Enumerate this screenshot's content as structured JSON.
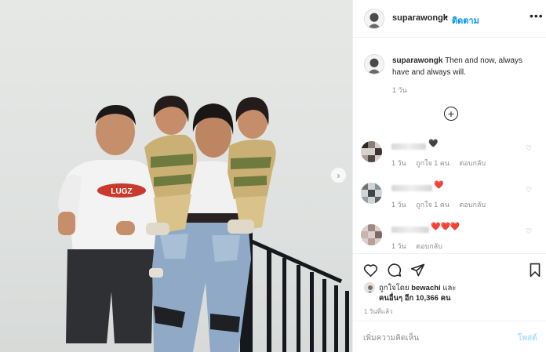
{
  "header": {
    "username": "suparawongk",
    "separator": "•",
    "follow_label": "ติดตาม",
    "more_icon": "more-horizontal-icon",
    "more_glyph": "•••"
  },
  "photo": {
    "next_glyph": "›",
    "shirt_logo": "LUGZ"
  },
  "caption": {
    "username": "suparawongk",
    "text": " Then and now, always have and always will.",
    "time": "1 วัน"
  },
  "load_more_glyph": "+",
  "comments": [
    {
      "emoji": "🖤",
      "time": "1 วัน",
      "likes": "ถูกใจ 1 คน",
      "reply": "ตอบกลับ",
      "heart_glyph": "♡"
    },
    {
      "emoji": "❤️",
      "time": "1 วัน",
      "likes": "ถูกใจ 1 คน",
      "reply": "ตอบกลับ",
      "heart_glyph": "♡"
    },
    {
      "emoji": "❤️❤️❤️",
      "time": "1 วัน",
      "reply": "ตอบกลับ",
      "heart_glyph": "♡"
    }
  ],
  "actions": {
    "like_icon": "heart-outline-icon",
    "comment_icon": "comment-bubble-icon",
    "share_icon": "paper-plane-icon",
    "save_icon": "bookmark-icon"
  },
  "likes": {
    "prefix": "ถูกใจโดย ",
    "user": "bewachi",
    "and": " และ",
    "others": "คนอื่นๆ อีก 10,366 คน"
  },
  "post_time": "1 วันที่แล้ว",
  "comment_box": {
    "placeholder": "เพิ่มความคิดเห็น",
    "post_label": "โพสต์"
  }
}
